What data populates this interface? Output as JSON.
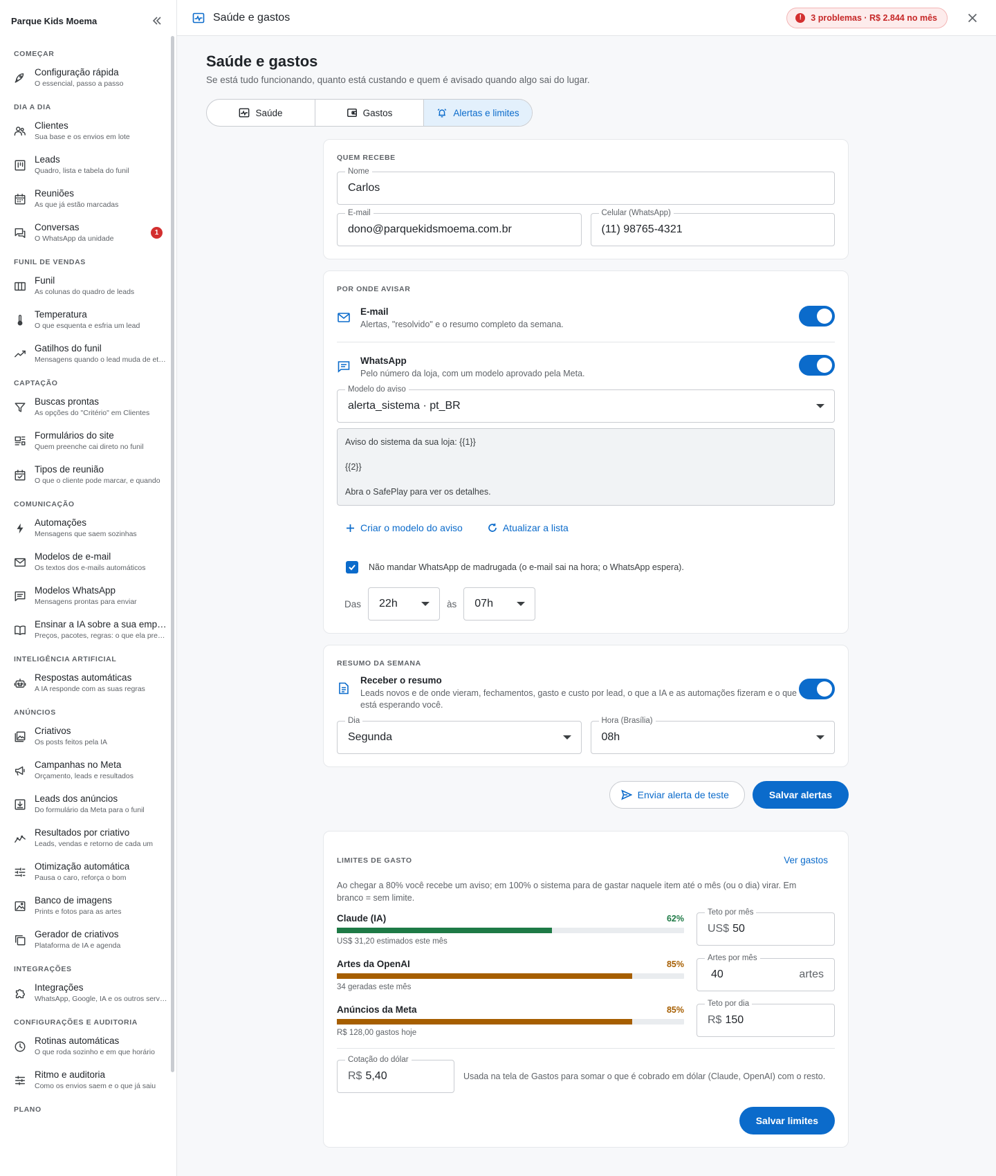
{
  "sidebar": {
    "brand": "Parque Kids Moema",
    "sections": [
      {
        "title": "COMEÇAR",
        "items": [
          {
            "icon": "rocket-icon",
            "label": "Configuração rápida",
            "sub": "O essencial, passo a passo"
          }
        ]
      },
      {
        "title": "DIA A DIA",
        "items": [
          {
            "icon": "users-icon",
            "label": "Clientes",
            "sub": "Sua base e os envios em lote"
          },
          {
            "icon": "kanban-icon",
            "label": "Leads",
            "sub": "Quadro, lista e tabela do funil"
          },
          {
            "icon": "calendar-icon",
            "label": "Reuniões",
            "sub": "As que já estão marcadas"
          },
          {
            "icon": "chat-icon",
            "label": "Conversas",
            "sub": "O WhatsApp da unidade",
            "badge": "1"
          }
        ]
      },
      {
        "title": "FUNIL DE VENDAS",
        "items": [
          {
            "icon": "columns-icon",
            "label": "Funil",
            "sub": "As colunas do quadro de leads"
          },
          {
            "icon": "thermometer-icon",
            "label": "Temperatura",
            "sub": "O que esquenta e esfria um lead"
          },
          {
            "icon": "trend-icon",
            "label": "Gatilhos do funil",
            "sub": "Mensagens quando o lead muda de etapa"
          }
        ]
      },
      {
        "title": "CAPTAÇÃO",
        "items": [
          {
            "icon": "filter-icon",
            "label": "Buscas prontas",
            "sub": "As opções do \"Critério\" em Clientes"
          },
          {
            "icon": "form-icon",
            "label": "Formulários do site",
            "sub": "Quem preenche cai direto no funil"
          },
          {
            "icon": "calendar-check-icon",
            "label": "Tipos de reunião",
            "sub": "O que o cliente pode marcar, e quando"
          }
        ]
      },
      {
        "title": "COMUNICAÇÃO",
        "items": [
          {
            "icon": "bolt-icon",
            "label": "Automações",
            "sub": "Mensagens que saem sozinhas"
          },
          {
            "icon": "mail-icon",
            "label": "Modelos de e-mail",
            "sub": "Os textos dos e-mails automáticos"
          },
          {
            "icon": "message-icon",
            "label": "Modelos WhatsApp",
            "sub": "Mensagens prontas para enviar"
          },
          {
            "icon": "book-icon",
            "label": "Ensinar a IA sobre a sua empresa",
            "sub": "Preços, pacotes, regras: o que ela precisa saber"
          }
        ]
      },
      {
        "title": "INTELIGÊNCIA ARTIFICIAL",
        "items": [
          {
            "icon": "robot-icon",
            "label": "Respostas automáticas",
            "sub": "A IA responde com as suas regras"
          }
        ]
      },
      {
        "title": "ANÚNCIOS",
        "items": [
          {
            "icon": "image-stack-icon",
            "label": "Criativos",
            "sub": "Os posts feitos pela IA"
          },
          {
            "icon": "megaphone-icon",
            "label": "Campanhas no Meta",
            "sub": "Orçamento, leads e resultados"
          },
          {
            "icon": "download-box-icon",
            "label": "Leads dos anúncios",
            "sub": "Do formulário da Meta para o funil"
          },
          {
            "icon": "chart-line-icon",
            "label": "Resultados por criativo",
            "sub": "Leads, vendas e retorno de cada um"
          },
          {
            "icon": "sliders-icon",
            "label": "Otimização automática",
            "sub": "Pausa o caro, reforça o bom"
          },
          {
            "icon": "photo-icon",
            "label": "Banco de imagens",
            "sub": "Prints e fotos para as artes"
          },
          {
            "icon": "copy-icon",
            "label": "Gerador de criativos",
            "sub": "Plataforma de IA e agenda"
          }
        ]
      },
      {
        "title": "INTEGRAÇÕES",
        "items": [
          {
            "icon": "puzzle-icon",
            "label": "Integrações",
            "sub": "WhatsApp, Google, IA e os outros serviços"
          }
        ]
      },
      {
        "title": "CONFIGURAÇÕES E AUDITORIA",
        "items": [
          {
            "icon": "clock-icon",
            "label": "Rotinas automáticas",
            "sub": "O que roda sozinho e em que horário"
          },
          {
            "icon": "tune-icon",
            "label": "Ritmo e auditoria",
            "sub": "Como os envios saem e o que já saiu"
          }
        ]
      },
      {
        "title": "PLANO",
        "items": []
      }
    ]
  },
  "topbar": {
    "title": "Saúde e gastos",
    "problems_chip": "3 problemas · R$ 2.844 no mês",
    "problems_dot": "!"
  },
  "page": {
    "title": "Saúde e gastos",
    "subtitle": "Se está tudo funcionando, quanto está custando e quem é avisado quando algo sai do lugar."
  },
  "tabs": [
    {
      "label": "Saúde",
      "icon": "pulse-icon",
      "active": false
    },
    {
      "label": "Gastos",
      "icon": "wallet-icon",
      "active": false
    },
    {
      "label": "Alertas e limites",
      "icon": "alarm-icon",
      "active": true
    }
  ],
  "recipient": {
    "heading": "QUEM RECEBE",
    "name_label": "Nome",
    "name_value": "Carlos",
    "email_label": "E-mail",
    "email_value": "dono@parquekidsmoema.com.br",
    "phone_label": "Celular (WhatsApp)",
    "phone_value": "(11) 98765-4321"
  },
  "channels": {
    "heading": "POR ONDE AVISAR",
    "email_title": "E-mail",
    "email_sub": "Alertas, \"resolvido\" e o resumo completo da semana.",
    "whatsapp_title": "WhatsApp",
    "whatsapp_sub": "Pelo número da loja, com um modelo aprovado pela Meta.",
    "template_label": "Modelo do aviso",
    "template_value": "alerta_sistema · pt_BR",
    "preview_line1": "Aviso do sistema da sua loja: {{1}}",
    "preview_line2": "{{2}}",
    "preview_line3": "Abra o SafePlay para ver os detalhes.",
    "create_template": "Criar o modelo do aviso",
    "refresh_list": "Atualizar a lista",
    "quiet_hours_label": "Não mandar WhatsApp de madrugada (o e-mail sai na hora; o WhatsApp espera).",
    "from_label": "Das",
    "from_value": "22h",
    "to_label": "às",
    "to_value": "07h"
  },
  "weekly": {
    "heading": "RESUMO DA SEMANA",
    "title": "Receber o resumo",
    "sub": "Leads novos e de onde vieram, fechamentos, gasto e custo por lead, o que a IA e as automações fizeram e o que está esperando você.",
    "day_label": "Dia",
    "day_value": "Segunda",
    "hour_label": "Hora (Brasília)",
    "hour_value": "08h"
  },
  "actions": {
    "send_test": "Enviar alerta de teste",
    "save_alerts": "Salvar alertas"
  },
  "limits": {
    "heading": "LIMITES DE GASTO",
    "view_costs": "Ver gastos",
    "description": "Ao chegar a 80% você recebe um aviso; em 100% o sistema para de gastar naquele item até o mês (ou o dia) virar. Em branco = sem limite.",
    "items": [
      {
        "name": "Claude (IA)",
        "pct_label": "62%",
        "pct": 62,
        "color": "#1e7a46",
        "note": "US$ 31,20 estimados este mês",
        "field_label": "Teto por mês",
        "field_prefix": "US$",
        "field_value": "50",
        "field_suffix": ""
      },
      {
        "name": "Artes da OpenAI",
        "pct_label": "85%",
        "pct": 85,
        "color": "#a65e00",
        "note": "34 geradas este mês",
        "field_label": "Artes por mês",
        "field_prefix": "",
        "field_value": "40",
        "field_suffix": "artes"
      },
      {
        "name": "Anúncios da Meta",
        "pct_label": "85%",
        "pct": 85,
        "color": "#a65e00",
        "note": "R$ 128,00 gastos hoje",
        "field_label": "Teto por dia",
        "field_prefix": "R$",
        "field_value": "150",
        "field_suffix": ""
      }
    ],
    "dollar_label": "Cotação do dólar",
    "dollar_prefix": "R$",
    "dollar_value": "5,40",
    "dollar_note": "Usada na tela de Gastos para somar o que é cobrado em dólar (Claude, OpenAI) com o resto.",
    "save_limits": "Salvar limites"
  }
}
